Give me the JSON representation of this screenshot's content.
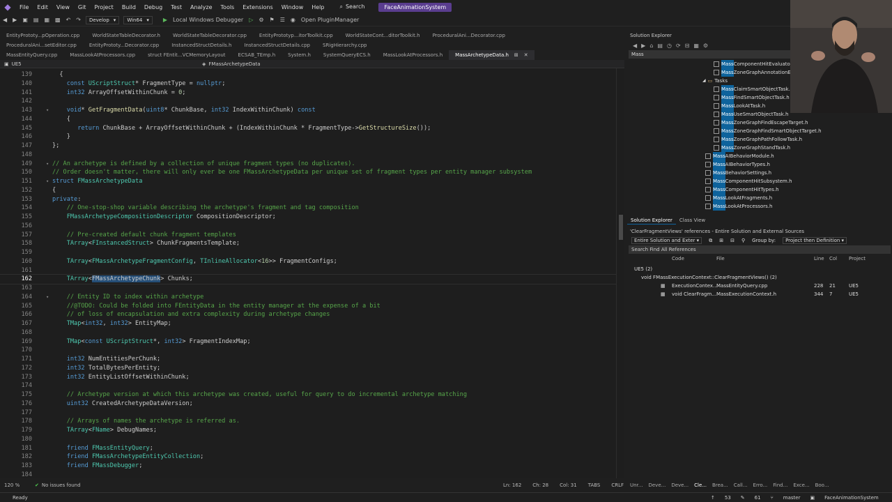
{
  "menu": {
    "items": [
      "File",
      "Edit",
      "View",
      "Git",
      "Project",
      "Build",
      "Debug",
      "Test",
      "Analyze",
      "Tools",
      "Extensions",
      "Window",
      "Help"
    ],
    "search": "Search",
    "solution": "FaceAnimationSystem"
  },
  "toolbar": {
    "config": "Develop",
    "platform": "Win64",
    "debugger": "Local Windows Debugger",
    "plugin": "Open PluginManager"
  },
  "tabs_row1": [
    "EntityPrototy...pOperation.cpp",
    "WorldStateTableDecorator.h",
    "WorldStateTableDecorator.cpp",
    "EntityPrototyp...itorToolkit.cpp",
    "WorldStateCont...ditorToolkit.h",
    "ProceduralAni...Decorator.cpp"
  ],
  "tabs_row2": [
    "ProceduralAni...setEditor.cpp",
    "EntityPrototy...Decorator.cpp",
    "InstancedStructDetails.h",
    "InstancedStructDetails.cpp",
    "SRigHierarchy.cpp"
  ],
  "tabs_row3": [
    "MassEntityQuery.cpp",
    "MassLookAtProcessors.cpp",
    "struct FEntit...VCMemoryLayout",
    "ECSAB_TEmp.h",
    "System.h",
    "SystemQueryECS.h",
    "MassLookAtProcessors.h",
    "MassArchetypeData.h"
  ],
  "editor": {
    "project": "UE5",
    "scope": "FMassArchetypeData",
    "lines": [
      {
        "n": "139",
        "t": [
          [
            "  {",
            ""
          ]
        ]
      },
      {
        "n": "140",
        "t": [
          [
            "    ",
            ""
          ],
          [
            "const",
            "kw"
          ],
          [
            " ",
            ""
          ],
          [
            "UScriptStruct",
            "ty"
          ],
          [
            "* FragmentType = ",
            ""
          ],
          [
            "nullptr",
            "kw"
          ],
          [
            ";",
            ""
          ]
        ]
      },
      {
        "n": "141",
        "t": [
          [
            "    ",
            ""
          ],
          [
            "int32",
            "kw"
          ],
          [
            " ArrayOffsetWithinChunk = ",
            ""
          ],
          [
            "0",
            "nm"
          ],
          [
            ";",
            ""
          ]
        ]
      },
      {
        "n": "142",
        "t": [
          [
            "",
            ""
          ]
        ]
      },
      {
        "n": "143",
        "t": [
          [
            "    ",
            ""
          ],
          [
            "void",
            "kw"
          ],
          [
            "* ",
            ""
          ],
          [
            "GetFragmentData",
            "fn"
          ],
          [
            "(",
            ""
          ],
          [
            "uint8",
            "kw"
          ],
          [
            "* ChunkBase, ",
            ""
          ],
          [
            "int32",
            "kw"
          ],
          [
            " IndexWithinChunk) ",
            ""
          ],
          [
            "const",
            "kw"
          ]
        ],
        "f": "v"
      },
      {
        "n": "144",
        "t": [
          [
            "    {",
            ""
          ]
        ]
      },
      {
        "n": "145",
        "t": [
          [
            "       ",
            ""
          ],
          [
            "return",
            "kw"
          ],
          [
            " ChunkBase + ArrayOffsetWithinChunk + (IndexWithinChunk * FragmentType->",
            ""
          ],
          [
            "GetStructureSize",
            "fn"
          ],
          [
            "());",
            ""
          ]
        ]
      },
      {
        "n": "146",
        "t": [
          [
            "    }",
            ""
          ]
        ]
      },
      {
        "n": "147",
        "t": [
          [
            "};",
            ""
          ]
        ]
      },
      {
        "n": "148",
        "t": [
          [
            "",
            ""
          ]
        ]
      },
      {
        "n": "149",
        "t": [
          [
            "// An archetype is defined by a collection of unique fragment types (no duplicates).",
            "cm"
          ]
        ],
        "f": "v"
      },
      {
        "n": "150",
        "t": [
          [
            "// Order doesn't matter, there will only ever be one FMassArchetypeData per unique set of fragment types per entity manager subsystem",
            "cm"
          ]
        ]
      },
      {
        "n": "151",
        "t": [
          [
            "struct",
            "kw"
          ],
          [
            " ",
            ""
          ],
          [
            "FMassArchetypeData",
            "ty"
          ]
        ],
        "f": "v"
      },
      {
        "n": "152",
        "t": [
          [
            "{",
            ""
          ]
        ]
      },
      {
        "n": "153",
        "t": [
          [
            "private",
            "kw"
          ],
          [
            ":",
            ""
          ]
        ]
      },
      {
        "n": "154",
        "t": [
          [
            "    ",
            ""
          ],
          [
            "// One-stop-shop variable describing the archetype's fragment and tag composition",
            "cm"
          ]
        ]
      },
      {
        "n": "155",
        "t": [
          [
            "    ",
            ""
          ],
          [
            "FMassArchetypeCompositionDescriptor",
            "ty"
          ],
          [
            " CompositionDescriptor;",
            ""
          ]
        ]
      },
      {
        "n": "156",
        "t": [
          [
            "",
            ""
          ]
        ]
      },
      {
        "n": "157",
        "t": [
          [
            "    ",
            ""
          ],
          [
            "// Pre-created default chunk fragment templates",
            "cm"
          ]
        ]
      },
      {
        "n": "158",
        "t": [
          [
            "    ",
            ""
          ],
          [
            "TArray",
            "ty"
          ],
          [
            "<",
            ""
          ],
          [
            "FInstancedStruct",
            "ty"
          ],
          [
            "> ChunkFragmentsTemplate;",
            ""
          ]
        ]
      },
      {
        "n": "159",
        "t": [
          [
            "",
            ""
          ]
        ]
      },
      {
        "n": "160",
        "t": [
          [
            "    ",
            ""
          ],
          [
            "TArray",
            "ty"
          ],
          [
            "<",
            ""
          ],
          [
            "FMassArchetypeFragmentConfig",
            "ty"
          ],
          [
            ", ",
            ""
          ],
          [
            "TInlineAllocator",
            "ty"
          ],
          [
            "<",
            ""
          ],
          [
            "16",
            "nm"
          ],
          [
            ">> FragmentConfigs;",
            ""
          ]
        ]
      },
      {
        "n": "161",
        "t": [
          [
            "",
            ""
          ]
        ]
      },
      {
        "n": "162",
        "t": [
          [
            "    ",
            ""
          ],
          [
            "TArray",
            "ty"
          ],
          [
            "<",
            ""
          ],
          [
            "FMassArchetypeChunk",
            "hl"
          ],
          [
            "> Chunks;",
            ""
          ]
        ],
        "cur": true
      },
      {
        "n": "163",
        "t": [
          [
            "",
            ""
          ]
        ]
      },
      {
        "n": "164",
        "t": [
          [
            "    ",
            ""
          ],
          [
            "// Entity ID to index within archetype",
            "cm"
          ]
        ],
        "f": "v"
      },
      {
        "n": "165",
        "t": [
          [
            "    ",
            ""
          ],
          [
            "//@TODO: Could be folded into FEntityData in the entity manager at the expense of a bit",
            "cm"
          ]
        ]
      },
      {
        "n": "166",
        "t": [
          [
            "    ",
            ""
          ],
          [
            "// of loss of encapsulation and extra complexity during archetype changes",
            "cm"
          ]
        ]
      },
      {
        "n": "167",
        "t": [
          [
            "    ",
            ""
          ],
          [
            "TMap",
            "ty"
          ],
          [
            "<",
            ""
          ],
          [
            "int32",
            "kw"
          ],
          [
            ", ",
            ""
          ],
          [
            "int32",
            "kw"
          ],
          [
            "> EntityMap;",
            ""
          ]
        ]
      },
      {
        "n": "168",
        "t": [
          [
            "",
            ""
          ]
        ]
      },
      {
        "n": "169",
        "t": [
          [
            "    ",
            ""
          ],
          [
            "TMap",
            "ty"
          ],
          [
            "<",
            ""
          ],
          [
            "const",
            "kw"
          ],
          [
            " ",
            ""
          ],
          [
            "UScriptStruct",
            "ty"
          ],
          [
            "*, ",
            ""
          ],
          [
            "int32",
            "kw"
          ],
          [
            "> FragmentIndexMap;",
            ""
          ]
        ]
      },
      {
        "n": "170",
        "t": [
          [
            "",
            ""
          ]
        ]
      },
      {
        "n": "171",
        "t": [
          [
            "    ",
            ""
          ],
          [
            "int32",
            "kw"
          ],
          [
            " NumEntitiesPerChunk;",
            ""
          ]
        ]
      },
      {
        "n": "172",
        "t": [
          [
            "    ",
            ""
          ],
          [
            "int32",
            "kw"
          ],
          [
            " TotalBytesPerEntity;",
            ""
          ]
        ]
      },
      {
        "n": "173",
        "t": [
          [
            "    ",
            ""
          ],
          [
            "int32",
            "kw"
          ],
          [
            " EntityListOffsetWithinChunk;",
            ""
          ]
        ]
      },
      {
        "n": "174",
        "t": [
          [
            "",
            ""
          ]
        ]
      },
      {
        "n": "175",
        "t": [
          [
            "    ",
            ""
          ],
          [
            "// Archetype version at which this archetype was created, useful for query to do incremental archetype matching",
            "cm"
          ]
        ]
      },
      {
        "n": "176",
        "t": [
          [
            "    ",
            ""
          ],
          [
            "uint32",
            "kw"
          ],
          [
            " CreatedArchetypeDataVersion;",
            ""
          ]
        ]
      },
      {
        "n": "177",
        "t": [
          [
            "",
            ""
          ]
        ]
      },
      {
        "n": "178",
        "t": [
          [
            "    ",
            ""
          ],
          [
            "// Arrays of names the archetype is referred as.",
            "cm"
          ]
        ]
      },
      {
        "n": "179",
        "t": [
          [
            "    ",
            ""
          ],
          [
            "TArray",
            "ty"
          ],
          [
            "<",
            ""
          ],
          [
            "FName",
            "ty"
          ],
          [
            "> DebugNames;",
            ""
          ]
        ]
      },
      {
        "n": "180",
        "t": [
          [
            "",
            ""
          ]
        ]
      },
      {
        "n": "181",
        "t": [
          [
            "    ",
            ""
          ],
          [
            "friend",
            "kw"
          ],
          [
            " ",
            ""
          ],
          [
            "FMassEntityQuery",
            "ty"
          ],
          [
            ";",
            ""
          ]
        ]
      },
      {
        "n": "182",
        "t": [
          [
            "    ",
            ""
          ],
          [
            "friend",
            "kw"
          ],
          [
            " ",
            ""
          ],
          [
            "FMassArchetypeEntityCollection",
            "ty"
          ],
          [
            ";",
            ""
          ]
        ]
      },
      {
        "n": "183",
        "t": [
          [
            "    ",
            ""
          ],
          [
            "friend",
            "kw"
          ],
          [
            " ",
            ""
          ],
          [
            "FMassDebugger",
            "ty"
          ],
          [
            ";",
            ""
          ]
        ]
      },
      {
        "n": "184",
        "t": [
          [
            "",
            ""
          ]
        ]
      },
      {
        "n": "185",
        "t": [
          [
            "public",
            "kw"
          ],
          [
            ":",
            ""
          ]
        ]
      }
    ]
  },
  "editor_status": {
    "zoom": "120 %",
    "issues": "No issues found",
    "ln": "Ln: 162",
    "ch": "Ch: 28",
    "col": "Col: 31",
    "tabs": "TABS",
    "crlf": "CRLF"
  },
  "solution_explorer": {
    "title": "Solution Explorer",
    "search_value": "Mass",
    "items": [
      {
        "hl": "Mass",
        "rest": "ComponentHitEvaluator"
      },
      {
        "hl": "Mass",
        "rest": "ZoneGraphAnnotationEv"
      },
      {
        "folder": "Tasks"
      },
      {
        "hl": "Mass",
        "rest": "ClaimSmartObjectTask.h"
      },
      {
        "hl": "Mass",
        "rest": "FindSmartObjectTask.h"
      },
      {
        "hl": "Mass",
        "rest": "LookAtTask.h"
      },
      {
        "hl": "Mass",
        "rest": "UseSmartObjectTask.h"
      },
      {
        "hl": "Mass",
        "rest": "ZoneGraphFindEscapeTarget.h"
      },
      {
        "hl": "Mass",
        "rest": "ZoneGraphFindSmartObjectTarget.h"
      },
      {
        "hl": "Mass",
        "rest": "ZoneGraphPathFollowTask.h"
      },
      {
        "hl": "Mass",
        "rest": "ZoneGraphStandTask.h"
      },
      {
        "hl": "Mass",
        "rest": "AIBehaviorModule.h"
      },
      {
        "hl": "Mass",
        "rest": "AIBehaviorTypes.h"
      },
      {
        "hl": "Mass",
        "rest": "BehaviorSettings.h"
      },
      {
        "hl": "Mass",
        "rest": "ComponentHitSubsystem.h"
      },
      {
        "hl": "Mass",
        "rest": "ComponentHitTypes.h"
      },
      {
        "hl": "Mass",
        "rest": "LookAtFragments.h"
      },
      {
        "hl": "Mass",
        "rest": "LookAtProcessors.h"
      }
    ],
    "tabs": [
      "Solution Explorer",
      "Class View"
    ]
  },
  "refs": {
    "title": "'ClearFragmentViews' references - Entire Solution and External Sources",
    "scope": "Entire Solution and Exter",
    "group_label": "Group by:",
    "group_value": "Project then Definition",
    "find_placeholder": "Search Find All References",
    "columns": [
      "Code",
      "File",
      "Line",
      "Col",
      "Project"
    ],
    "group": "UE5 (2)",
    "def": "void FMassExecutionContext::ClearFragmentViews() (2)",
    "rows": [
      {
        "code": "ExecutionContex...",
        "file": "MassEntityQuery.cpp",
        "line": "228",
        "col": "21",
        "project": "UE5"
      },
      {
        "code": "void ClearFragm...",
        "file": "MassExecutionContext.h",
        "line": "344",
        "col": "7",
        "project": "UE5"
      }
    ]
  },
  "bottom_tabs": [
    "Unr...",
    "Deve...",
    "Deve...",
    "Cle...",
    "Brea...",
    "Call...",
    "Erro...",
    "Find...",
    "Exce...",
    "Boo..."
  ],
  "statusbar": {
    "ready": "Ready",
    "up": "53",
    "pen": "61",
    "branch": "master",
    "repo": "FaceAnimationSystem"
  },
  "colors": {
    "accent": "#5a3d8f",
    "selection": "#264f78",
    "hl": "#0e639c"
  }
}
